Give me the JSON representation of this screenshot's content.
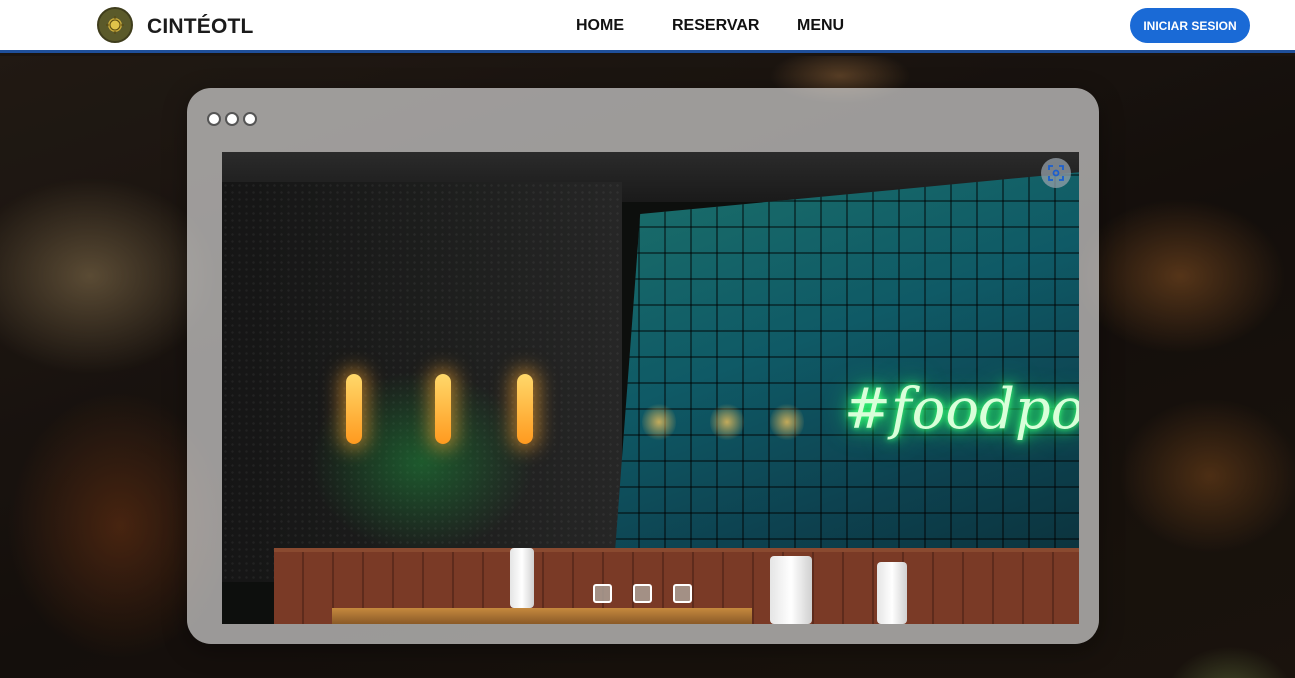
{
  "navbar": {
    "brand": "CINTÉOTL",
    "links": [
      "HOME",
      "RESERVAR",
      "MENU"
    ],
    "login_label": "INICIAR SESION",
    "accent_color": "#1a6ad6"
  },
  "carousel": {
    "neon_text": "#foodpo",
    "indicator_count": 3,
    "expand_icon": "fullscreen-icon"
  },
  "window_controls": {
    "dots": 3
  }
}
